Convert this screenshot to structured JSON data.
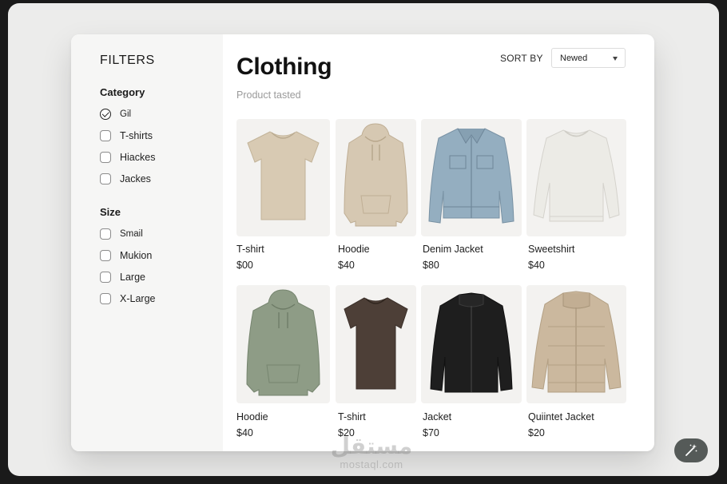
{
  "sidebar": {
    "title": "FILTERS",
    "category": {
      "title": "Category",
      "options": [
        {
          "label": "Gil",
          "checked": true
        },
        {
          "label": "T-shirts",
          "checked": false
        },
        {
          "label": "Hiackes",
          "checked": false
        },
        {
          "label": "Jackes",
          "checked": false
        }
      ]
    },
    "size": {
      "title": "Size",
      "options": [
        {
          "label": "Smail",
          "checked": false
        },
        {
          "label": "Mukion",
          "checked": false
        },
        {
          "label": "Large",
          "checked": false
        },
        {
          "label": "X-Large",
          "checked": false
        }
      ]
    }
  },
  "main": {
    "title": "Clothing",
    "subtitle": "Product tasted",
    "sort": {
      "label": "SORT BY",
      "value": "Newed"
    },
    "products": [
      {
        "name": "T-shirt",
        "price": "$00",
        "icon": "tshirt-icon",
        "color": "#d8cab3"
      },
      {
        "name": "Hoodie",
        "price": "$40",
        "icon": "hoodie-icon",
        "color": "#d6c8b2"
      },
      {
        "name": "Denim Jacket",
        "price": "$80",
        "icon": "denim-jacket-icon",
        "color": "#94aec0"
      },
      {
        "name": "Sweetshirt",
        "price": "$40",
        "icon": "sweatshirt-icon",
        "color": "#ecebe6"
      },
      {
        "name": "Hoodie",
        "price": "$40",
        "icon": "hoodie-icon",
        "color": "#8e9c86"
      },
      {
        "name": "T-shirt",
        "price": "$20",
        "icon": "tshirt-icon",
        "color": "#4d3f37"
      },
      {
        "name": "Jacket",
        "price": "$70",
        "icon": "jacket-icon",
        "color": "#1e1e1e"
      },
      {
        "name": "Quiintet Jacket",
        "price": "$20",
        "icon": "puffer-jacket-icon",
        "color": "#cbb89e"
      }
    ]
  },
  "watermark": {
    "arabic": "مستقل",
    "latin": "mostaql.com"
  },
  "fab": {
    "icon": "magic-wand-icon"
  }
}
